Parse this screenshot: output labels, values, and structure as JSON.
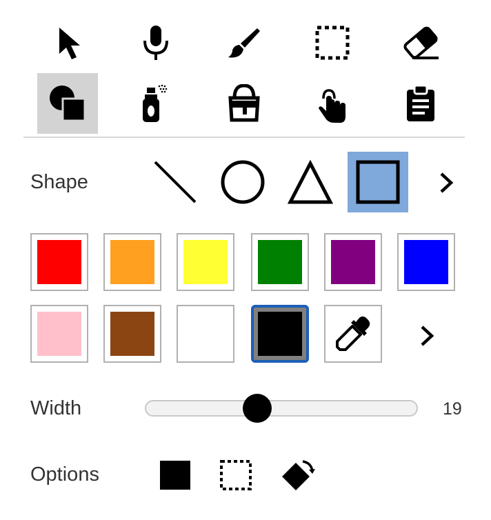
{
  "tools": [
    {
      "id": "select",
      "icon": "cursor-arrow-icon",
      "selected": false
    },
    {
      "id": "voice",
      "icon": "microphone-icon",
      "selected": false
    },
    {
      "id": "brush",
      "icon": "paintbrush-icon",
      "selected": false
    },
    {
      "id": "rect-select",
      "icon": "dashed-selection-icon",
      "selected": false
    },
    {
      "id": "eraser",
      "icon": "eraser-icon",
      "selected": false
    },
    {
      "id": "shapes",
      "icon": "shapes-icon",
      "selected": true
    },
    {
      "id": "spray",
      "icon": "spray-can-icon",
      "selected": false
    },
    {
      "id": "fill",
      "icon": "paint-bucket-icon",
      "selected": false
    },
    {
      "id": "touch",
      "icon": "touch-hand-icon",
      "selected": false
    },
    {
      "id": "clipboard",
      "icon": "clipboard-icon",
      "selected": false
    }
  ],
  "shape_section": {
    "label": "Shape",
    "options": [
      {
        "id": "line",
        "icon": "line-icon",
        "selected": false
      },
      {
        "id": "circle",
        "icon": "circle-icon",
        "selected": false
      },
      {
        "id": "triangle",
        "icon": "triangle-icon",
        "selected": false
      },
      {
        "id": "square",
        "icon": "square-icon",
        "selected": true
      }
    ],
    "more_icon": "chevron-right-icon",
    "selected_color": "#7fa8db"
  },
  "colors": {
    "row1": [
      "#ff0000",
      "#ffa020",
      "#ffff33",
      "#008000",
      "#800080",
      "#0000ff"
    ],
    "row2": [
      "#ffc0cb",
      "#8b4513",
      "#ffffff",
      "#000000"
    ],
    "selected": "#000000",
    "picker_icon": "eyedropper-icon",
    "more_icon": "chevron-right-icon",
    "selected_border": "#1e5fb8"
  },
  "width": {
    "label": "Width",
    "value": "19",
    "fraction": 0.4
  },
  "options": {
    "label": "Options",
    "items": [
      {
        "id": "filled",
        "icon": "filled-square-icon"
      },
      {
        "id": "outline",
        "icon": "dashed-square-icon"
      },
      {
        "id": "rotate",
        "icon": "rotate-diamond-icon"
      }
    ]
  }
}
